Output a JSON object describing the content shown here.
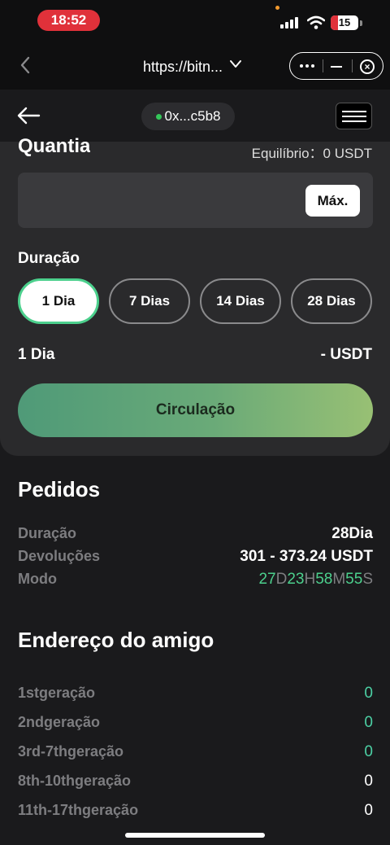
{
  "status_bar": {
    "time": "18:52",
    "battery": "15"
  },
  "browser": {
    "url": "https://bitn..."
  },
  "header": {
    "wallet": "0x...c5b8"
  },
  "stake": {
    "amount_label": "Quantia",
    "balance": "Equilíbrio：0 USDT",
    "max_label": "Máx.",
    "duration_label": "Duração",
    "duration_options": [
      "1 Dia",
      "7 Dias",
      "14 Dias",
      "28 Dias"
    ],
    "selected_duration": "1 Dia",
    "summary_left": "1 Dia",
    "summary_right": "- USDT",
    "submit_label": "Circulação"
  },
  "orders": {
    "title": "Pedidos",
    "duration_key": "Duração",
    "duration_value": "28Dia",
    "returns_key": "Devoluções",
    "returns_value": "301 - 373.24 USDT",
    "mode_key": "Modo",
    "countdown": {
      "days": "27",
      "d": "D",
      "hours": "23",
      "h": "H",
      "minutes": "58",
      "m": "M",
      "seconds": "55",
      "s": "S"
    }
  },
  "friends": {
    "title": "Endereço do amigo",
    "rows": [
      {
        "label": "1stgeração",
        "value": "0"
      },
      {
        "label": "2ndgeração",
        "value": "0"
      },
      {
        "label": "3rd-7thgeração",
        "value": "0"
      },
      {
        "label": "8th-10thgeração",
        "value": "0"
      },
      {
        "label": "11th-17thgeração",
        "value": "0"
      }
    ]
  },
  "colors": {
    "accent_green": "#4cd08d",
    "teal": "#4cd0a4",
    "record": "#e0313a"
  },
  "icons": [
    "signal-icon",
    "wifi-icon",
    "battery-icon",
    "chevron-left-icon",
    "chevron-down-icon",
    "more-icon",
    "minimize-icon",
    "close-icon",
    "arrow-left-icon",
    "menu-icon"
  ]
}
